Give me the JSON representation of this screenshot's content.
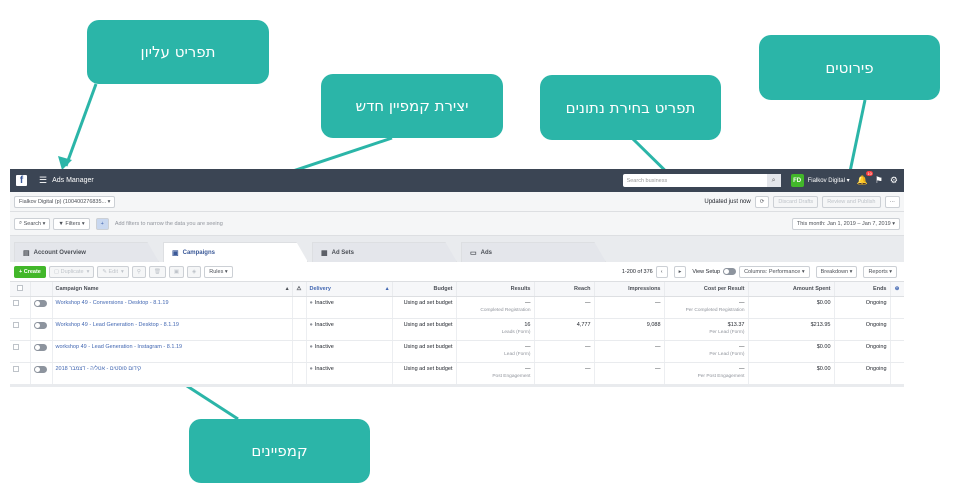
{
  "callouts": {
    "top_menu": "תפריט עליון",
    "new_campaign": "יצירת קמפיין חדש",
    "data_menu": "תפריט בחירת נתונים",
    "breakdowns": "פירוטים",
    "campaigns": "קמפיינים"
  },
  "topbar": {
    "logo": "f",
    "menu_icon": "☰",
    "app_name": "Ads Manager",
    "search_placeholder": "Search business",
    "avatar_text": "FD",
    "account_name": "Fialkov Digital",
    "notif_count": "10"
  },
  "account_bar": {
    "account_select": "Fialkov Digital (p) (100400276835...",
    "updated": "Updated just now",
    "discard": "Discard Drafts",
    "review": "Review and Publish",
    "more": "···"
  },
  "filter_bar": {
    "search": "Search",
    "filters": "Filters",
    "hint": "Add filters to narrow the data you are seeing",
    "date_range": "This month: Jan 1, 2019 – Jan 7, 2019"
  },
  "tabs": [
    {
      "label": "Account Overview"
    },
    {
      "label": "Campaigns"
    },
    {
      "label": "Ad Sets"
    },
    {
      "label": "Ads"
    }
  ],
  "actions": {
    "create": "Create",
    "duplicate": "Duplicate",
    "edit": "Edit",
    "rules": "Rules",
    "range": "1-200 of 376",
    "view_setup": "View Setup",
    "columns": "Columns: Performance",
    "breakdown": "Breakdown",
    "reports": "Reports"
  },
  "table": {
    "headers": {
      "name": "Campaign Name",
      "delivery": "Delivery",
      "budget": "Budget",
      "results": "Results",
      "reach": "Reach",
      "impressions": "Impressions",
      "cpr": "Cost per Result",
      "spent": "Amount Spent",
      "ends": "Ends"
    },
    "rows": [
      {
        "name": "Workshop 49 - Conversions - Desktop - 8.1.19",
        "delivery": "Inactive",
        "budget": "Using ad set budget",
        "results": "—",
        "results_sub": "Completed Registration",
        "reach": "—",
        "impressions": "—",
        "cpr": "—",
        "cpr_sub": "Per Completed Registration",
        "spent": "$0.00",
        "ends": "Ongoing"
      },
      {
        "name": "Workshop 49 - Lead Generation - Desktop - 8.1.19",
        "delivery": "Inactive",
        "budget": "Using ad set budget",
        "results": "16",
        "results_sub": "Leads (Form)",
        "reach": "4,777",
        "impressions": "9,088",
        "cpr": "$13.37",
        "cpr_sub": "Per Lead (Form)",
        "spent": "$213.95",
        "ends": "Ongoing"
      },
      {
        "name": "workshop 49 - Lead Generation - Instagram - 8.1.19",
        "delivery": "Inactive",
        "budget": "Using ad set budget",
        "results": "—",
        "results_sub": "Lead (Form)",
        "reach": "—",
        "impressions": "—",
        "cpr": "—",
        "cpr_sub": "Per Lead (Form)",
        "spent": "$0.00",
        "ends": "Ongoing"
      },
      {
        "name": "קידום פוסטים - אטליה - דצמבר 2018",
        "delivery": "Inactive",
        "budget": "Using ad set budget",
        "results": "—",
        "results_sub": "Post Engagement",
        "reach": "—",
        "impressions": "—",
        "cpr": "—",
        "cpr_sub": "Per Post Engagement",
        "spent": "$0.00",
        "ends": "Ongoing"
      }
    ]
  },
  "colors": {
    "callout": "#2bb5a8",
    "topbar": "#3b4554",
    "create": "#42b72a",
    "link": "#4267b2"
  }
}
